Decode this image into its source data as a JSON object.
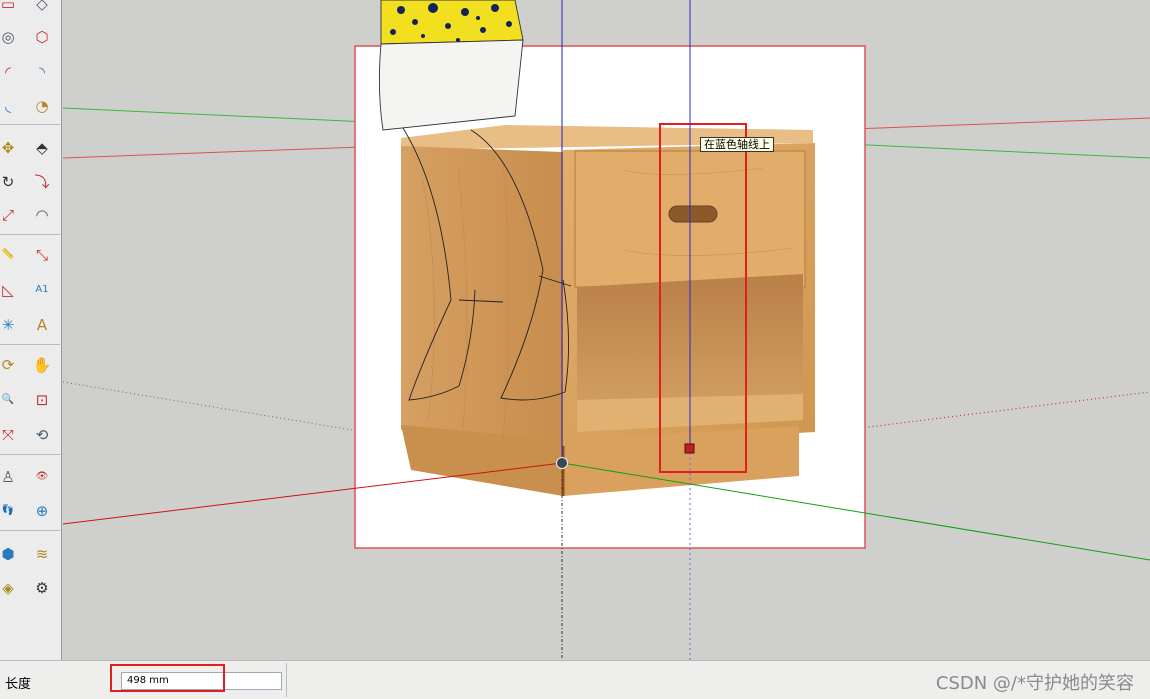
{
  "toolbar": {
    "tools": [
      {
        "name": "rectangle-tool-icon",
        "glyph": "▭"
      },
      {
        "name": "rotated-rectangle-tool-icon",
        "glyph": "◇"
      },
      {
        "name": "circle-tool-icon",
        "glyph": "◎"
      },
      {
        "name": "polygon-tool-icon",
        "glyph": "⬡"
      },
      {
        "name": "arc-tool-icon",
        "glyph": "◜"
      },
      {
        "name": "two-point-arc-tool-icon",
        "glyph": "◝"
      },
      {
        "name": "three-point-arc-tool-icon",
        "glyph": "◟"
      },
      {
        "name": "pie-tool-icon",
        "glyph": "◔"
      },
      {
        "name": "move-tool-icon",
        "glyph": "✥"
      },
      {
        "name": "push-pull-tool-icon",
        "glyph": "⬘"
      },
      {
        "name": "rotate-tool-icon",
        "glyph": "↻"
      },
      {
        "name": "follow-me-tool-icon",
        "glyph": "⤵"
      },
      {
        "name": "scale-tool-icon",
        "glyph": "⤢"
      },
      {
        "name": "offset-tool-icon",
        "glyph": "◠"
      },
      {
        "name": "tape-measure-tool-icon",
        "glyph": "📏"
      },
      {
        "name": "dimension-tool-icon",
        "glyph": "⤡"
      },
      {
        "name": "protractor-tool-icon",
        "glyph": "◺"
      },
      {
        "name": "text-tool-icon",
        "glyph": "A1"
      },
      {
        "name": "axes-tool-icon",
        "glyph": "✳"
      },
      {
        "name": "3d-text-tool-icon",
        "glyph": "A"
      },
      {
        "name": "orbit-tool-icon",
        "glyph": "⟳"
      },
      {
        "name": "pan-tool-icon",
        "glyph": "✋"
      },
      {
        "name": "zoom-tool-icon",
        "glyph": "🔍"
      },
      {
        "name": "zoom-window-tool-icon",
        "glyph": "⊡"
      },
      {
        "name": "zoom-extents-tool-icon",
        "glyph": "⤧"
      },
      {
        "name": "previous-view-tool-icon",
        "glyph": "⟲"
      },
      {
        "name": "position-camera-tool-icon",
        "glyph": "♙"
      },
      {
        "name": "look-around-tool-icon",
        "glyph": "👁"
      },
      {
        "name": "walk-tool-icon",
        "glyph": "👣"
      },
      {
        "name": "section-plane-tool-icon",
        "glyph": "⊕"
      },
      {
        "name": "sandbox-from-contours-icon",
        "glyph": "⬢"
      },
      {
        "name": "sandbox-from-scratch-icon",
        "glyph": "≋"
      },
      {
        "name": "sandbox-smoove-icon",
        "glyph": "◈"
      },
      {
        "name": "sandbox-stamp-icon",
        "glyph": "⚙"
      }
    ]
  },
  "viewport": {
    "tooltip": "在蓝色轴线上"
  },
  "colors": {
    "red_axis": "#d01010",
    "green_axis": "#10a010",
    "blue_axis": "#2020c0",
    "highlight": "#e02020",
    "wood": "#d9a05a",
    "background": "#cfcfcd"
  },
  "status": {
    "vcb_label": "长度",
    "vcb_value": "498 mm",
    "watermark": "CSDN @/*守护她的笑容"
  }
}
